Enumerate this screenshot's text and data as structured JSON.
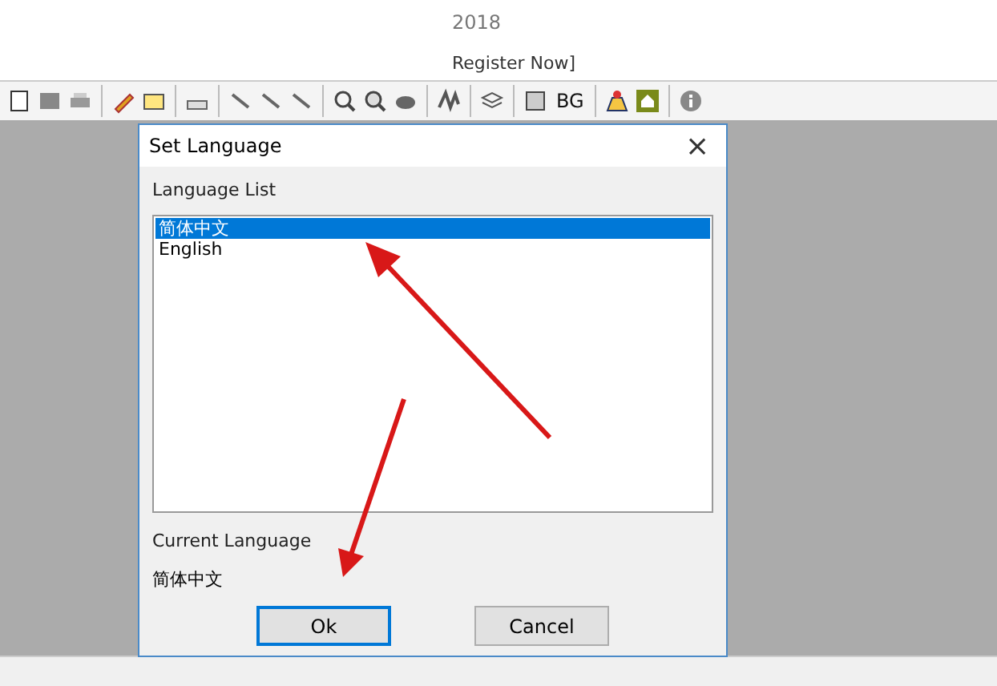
{
  "app": {
    "title": "2018",
    "registration": "Register Now]"
  },
  "toolbar": {
    "label": "BG"
  },
  "dialog": {
    "title": "Set Language",
    "close": "×",
    "list_label": "Language List",
    "languages": [
      {
        "label": "简体中文",
        "selected": true
      },
      {
        "label": "English",
        "selected": false
      }
    ],
    "current_label": "Current Language",
    "current_value": "简体中文",
    "buttons": [
      {
        "label": "Ok",
        "focused": true
      },
      {
        "label": "Cancel",
        "focused": false
      }
    ]
  }
}
